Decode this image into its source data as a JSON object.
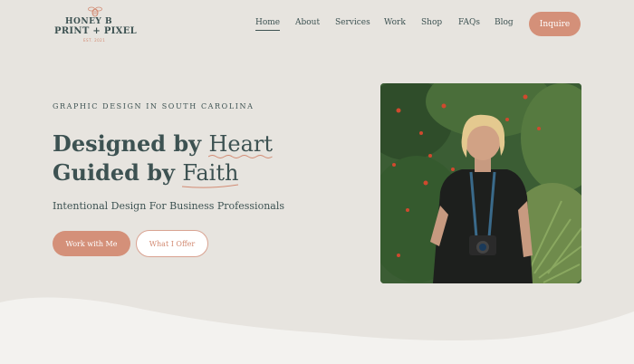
{
  "brand": {
    "line1": "HONEY B",
    "line2": "PRINT + PIXEL",
    "line3": "EST. 2021"
  },
  "nav": {
    "items": [
      "Home",
      "About",
      "Services",
      "Work",
      "Shop",
      "FAQs",
      "Blog"
    ],
    "active": "Home",
    "inquire_label": "Inquire"
  },
  "hero": {
    "eyebrow": "GRAPHIC DESIGN IN SOUTH CAROLINA",
    "line1_prefix": "Designed by ",
    "line1_script": "Heart",
    "line2_prefix": "Guided by ",
    "line2_script": "Faith",
    "subhead": "Intentional Design For Business Professionals",
    "primary_button": "Work with Me",
    "secondary_button": "What I Offer"
  },
  "colors": {
    "background": "#e7e4df",
    "text": "#3d5252",
    "accent": "#d49079",
    "wave": "#f3f2ef"
  }
}
